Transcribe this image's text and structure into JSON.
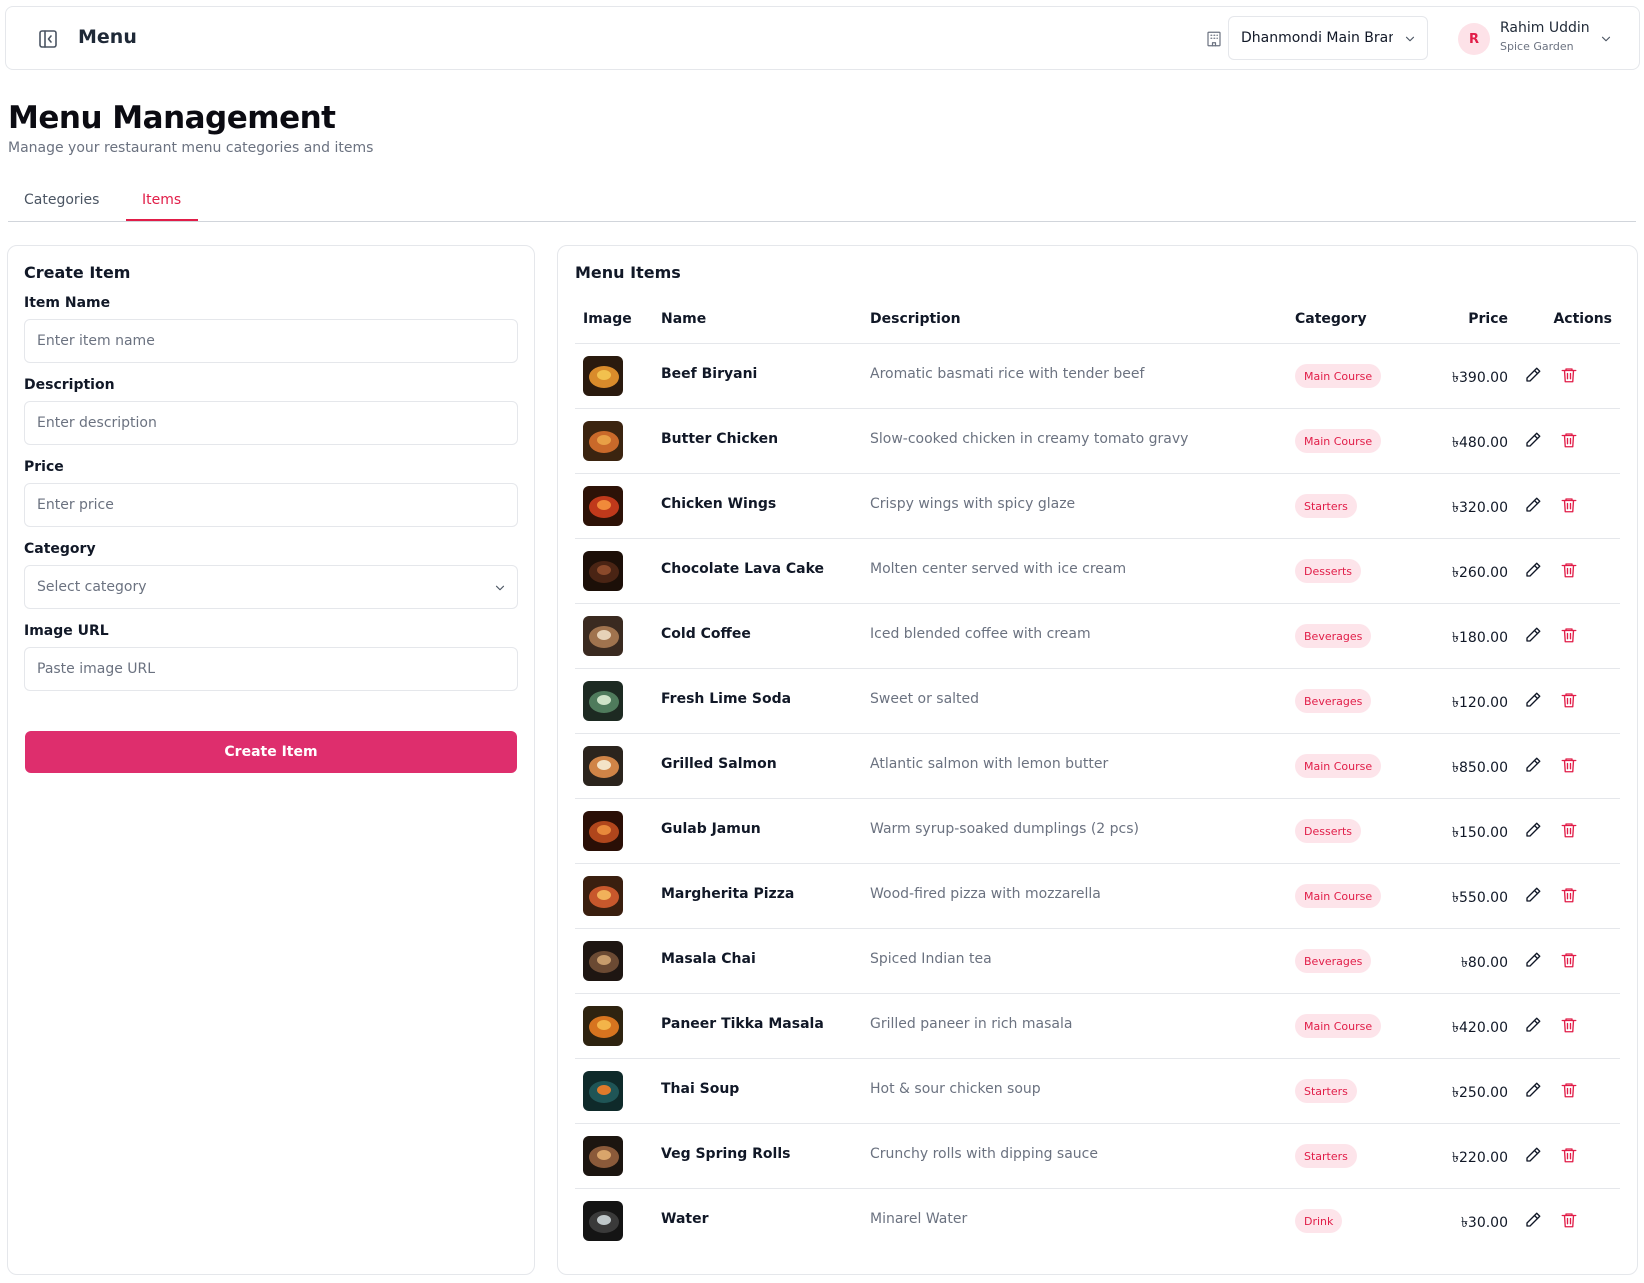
{
  "topbar": {
    "title": "Menu",
    "branch": "Dhanmondi Main Branch",
    "user_initial": "R",
    "user_name": "Rahim Uddin",
    "user_org": "Spice Garden"
  },
  "page": {
    "title": "Menu Management",
    "subtitle": "Manage your restaurant menu categories and items"
  },
  "tabs": [
    {
      "label": "Categories",
      "active": false
    },
    {
      "label": "Items",
      "active": true
    }
  ],
  "create_form": {
    "title": "Create Item",
    "name_label": "Item Name",
    "name_placeholder": "Enter item name",
    "description_label": "Description",
    "description_placeholder": "Enter description",
    "price_label": "Price",
    "price_placeholder": "Enter price",
    "category_label": "Category",
    "category_placeholder": "Select category",
    "image_label": "Image URL",
    "image_placeholder": "Paste image URL",
    "submit_label": "Create Item"
  },
  "menu_items": {
    "title": "Menu Items",
    "columns": [
      "Image",
      "Name",
      "Description",
      "Category",
      "Price",
      "Actions"
    ],
    "rows": [
      {
        "name": "Beef Biryani",
        "description": "Aromatic basmati rice with tender beef",
        "category": "Main Course",
        "price": "৳390.00"
      },
      {
        "name": "Butter Chicken",
        "description": "Slow-cooked chicken in creamy tomato gravy",
        "category": "Main Course",
        "price": "৳480.00"
      },
      {
        "name": "Chicken Wings",
        "description": "Crispy wings with spicy glaze",
        "category": "Starters",
        "price": "৳320.00"
      },
      {
        "name": "Chocolate Lava Cake",
        "description": "Molten center served with ice cream",
        "category": "Desserts",
        "price": "৳260.00"
      },
      {
        "name": "Cold Coffee",
        "description": "Iced blended coffee with cream",
        "category": "Beverages",
        "price": "৳180.00"
      },
      {
        "name": "Fresh Lime Soda",
        "description": "Sweet or salted",
        "category": "Beverages",
        "price": "৳120.00"
      },
      {
        "name": "Grilled Salmon",
        "description": "Atlantic salmon with lemon butter",
        "category": "Main Course",
        "price": "৳850.00"
      },
      {
        "name": "Gulab Jamun",
        "description": "Warm syrup-soaked dumplings (2 pcs)",
        "category": "Desserts",
        "price": "৳150.00"
      },
      {
        "name": "Margherita Pizza",
        "description": "Wood-fired pizza with mozzarella",
        "category": "Main Course",
        "price": "৳550.00"
      },
      {
        "name": "Masala Chai",
        "description": "Spiced Indian tea",
        "category": "Beverages",
        "price": "৳80.00"
      },
      {
        "name": "Paneer Tikka Masala",
        "description": "Grilled paneer in rich masala",
        "category": "Main Course",
        "price": "৳420.00"
      },
      {
        "name": "Thai Soup",
        "description": "Hot & sour chicken soup",
        "category": "Starters",
        "price": "৳250.00"
      },
      {
        "name": "Veg Spring Rolls",
        "description": "Crunchy rolls with dipping sauce",
        "category": "Starters",
        "price": "৳220.00"
      },
      {
        "name": "Water",
        "description": "Minarel Water",
        "category": "Drink",
        "price": "৳30.00"
      }
    ]
  },
  "colors": {
    "accent": "#e11d48",
    "button": "#de2e6d",
    "badge_bg": "#fde4ea"
  },
  "icons": {
    "sidebar_toggle": "panel-left-icon",
    "branch": "building-icon",
    "chevron": "chevron-down-icon",
    "edit": "pencil-icon",
    "delete": "trash-icon"
  }
}
